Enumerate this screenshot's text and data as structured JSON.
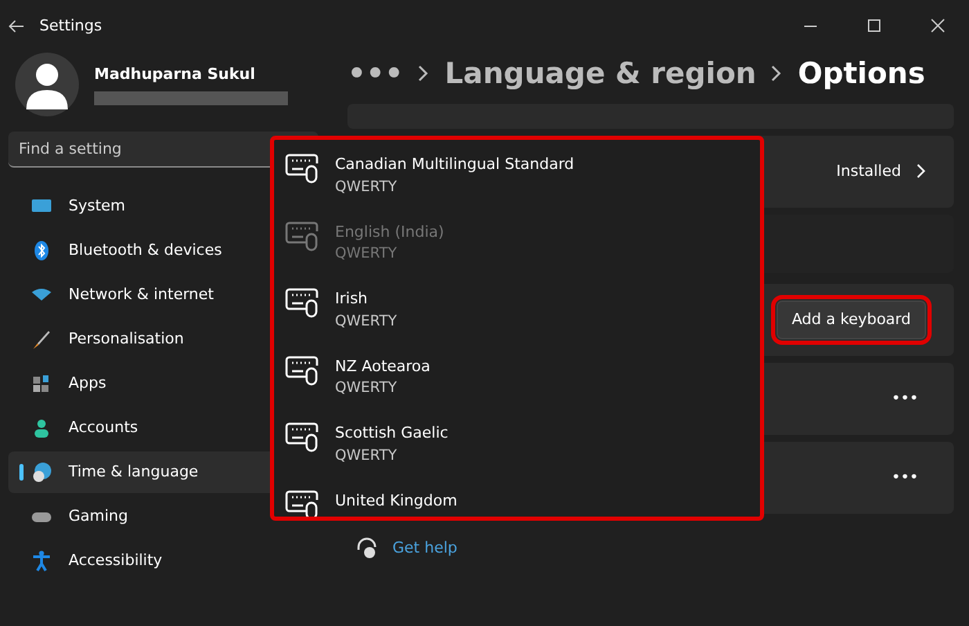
{
  "window": {
    "title": "Settings"
  },
  "user": {
    "name": "Madhuparna Sukul"
  },
  "search": {
    "placeholder": "Find a setting"
  },
  "sidebar": {
    "items": [
      {
        "label": "System",
        "selected": false
      },
      {
        "label": "Bluetooth & devices",
        "selected": false
      },
      {
        "label": "Network & internet",
        "selected": false
      },
      {
        "label": "Personalisation",
        "selected": false
      },
      {
        "label": "Apps",
        "selected": false
      },
      {
        "label": "Accounts",
        "selected": false
      },
      {
        "label": "Time & language",
        "selected": true
      },
      {
        "label": "Gaming",
        "selected": false
      },
      {
        "label": "Accessibility",
        "selected": false
      }
    ]
  },
  "breadcrumb": [
    {
      "label": "•••"
    },
    {
      "label": "Language & region"
    },
    {
      "label": "Options"
    }
  ],
  "cards": [
    {
      "kind": "blank"
    },
    {
      "kind": "status",
      "value": "Installed"
    },
    {
      "kind": "gap"
    },
    {
      "kind": "button",
      "button": "Add a keyboard",
      "highlighted": true
    },
    {
      "kind": "more",
      "menu": "•••"
    },
    {
      "kind": "more",
      "menu": "•••"
    }
  ],
  "keyboard_dropdown": {
    "highlighted": true,
    "items": [
      {
        "name": "Canadian Multilingual Standard",
        "layout": "QWERTY",
        "disabled": false
      },
      {
        "name": "English (India)",
        "layout": "QWERTY",
        "disabled": true
      },
      {
        "name": "Irish",
        "layout": "QWERTY",
        "disabled": false
      },
      {
        "name": "NZ Aotearoa",
        "layout": "QWERTY",
        "disabled": false
      },
      {
        "name": "Scottish Gaelic",
        "layout": "QWERTY",
        "disabled": false
      },
      {
        "name": "United Kingdom",
        "disabled": false
      }
    ]
  },
  "help_link": "Get help"
}
